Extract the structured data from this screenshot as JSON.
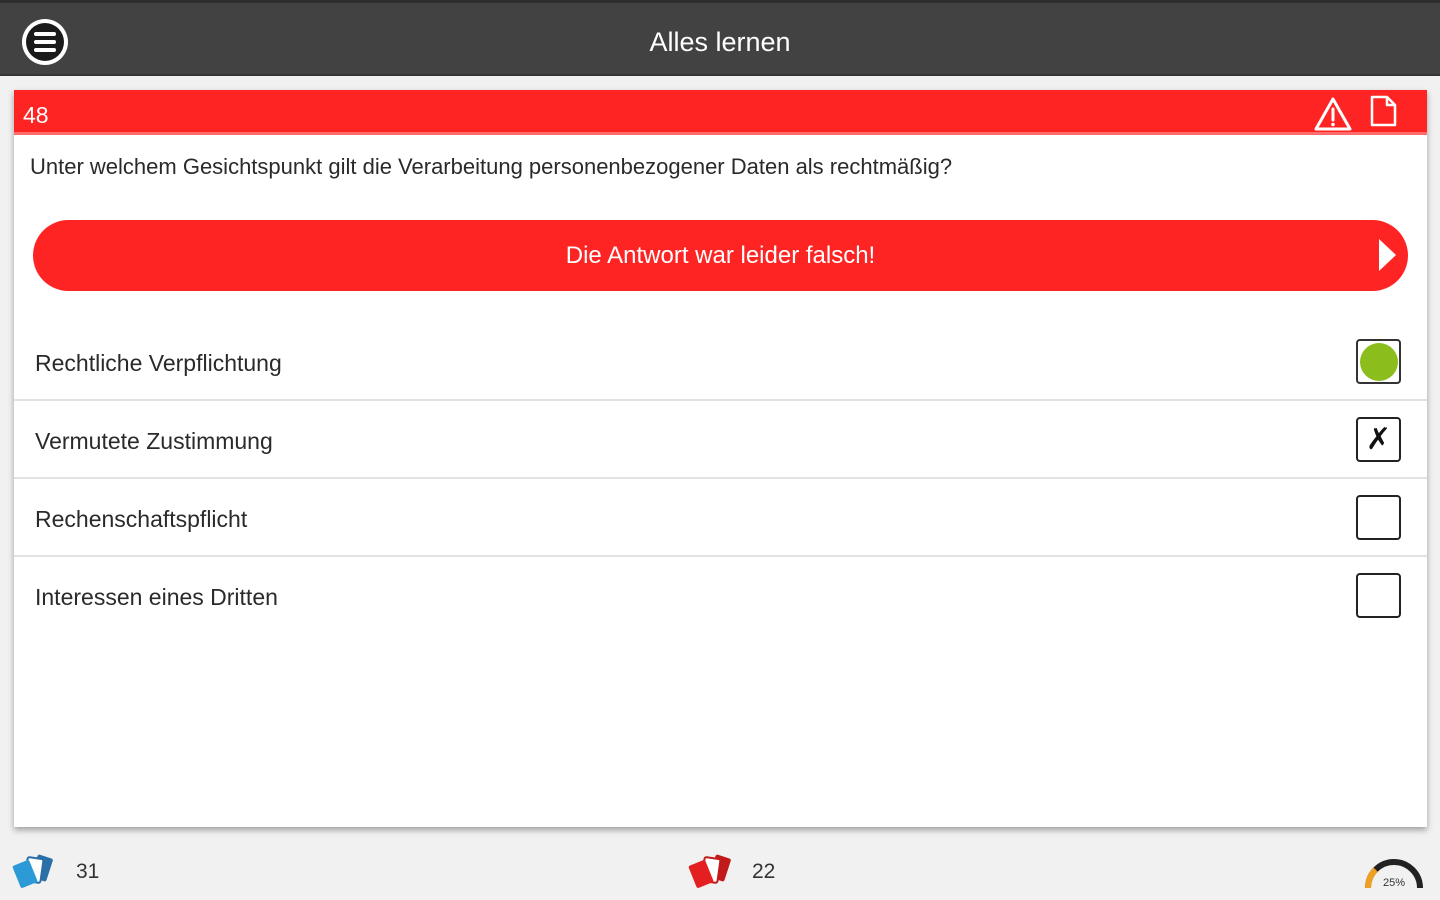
{
  "appbar": {
    "title": "Alles lernen",
    "menu_icon": "hamburger-menu-icon"
  },
  "card": {
    "question_number": "48",
    "header_icons": [
      "warning-triangle-icon",
      "document-icon"
    ],
    "question": "Unter welchem Gesichtspunkt gilt die Verarbeitung personenbezogener Daten als rechtmäßig?",
    "feedback": {
      "text": "Die Antwort war leider falsch!",
      "color": "#ff2424"
    },
    "answers": [
      {
        "text": "Rechtliche Verpflichtung",
        "state": "correct"
      },
      {
        "text": "Vermutete Zustimmung",
        "state": "wrong-selected"
      },
      {
        "text": "Rechenschaftspflicht",
        "state": "empty"
      },
      {
        "text": "Interessen eines Dritten",
        "state": "empty"
      }
    ]
  },
  "bottombar": {
    "learned_count": "31",
    "wrong_count": "22",
    "progress_percent": 25,
    "progress_label": "25%"
  },
  "colors": {
    "accent_red": "#ff2424",
    "correct_green": "#8bbd1c",
    "appbar_bg": "#424242"
  }
}
